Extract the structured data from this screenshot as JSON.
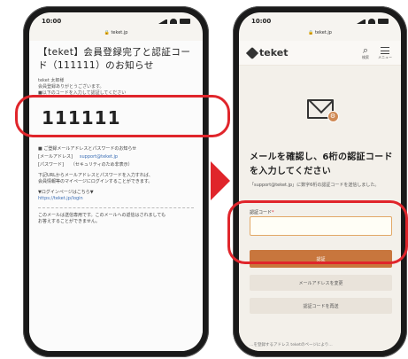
{
  "left_phone": {
    "status_time": "10:00",
    "url": "teket.jp",
    "mail": {
      "subject": "【teket】会員登録完了と認証コード（111111）のお知らせ",
      "greeting": "teket 太郎様",
      "meta_1": "会員登録ありがとうございます。",
      "meta_2": "■以下のコードを入力して認証してください",
      "code": "111111",
      "section_title": "■ ご登録メールアドレスとパスワードのお知らせ",
      "email_label": "[メールアドレス]",
      "email_value": "support@teket.jp",
      "password_label": "[パスワード]",
      "password_value": "（セキュリティのため非表示）",
      "para_1": "下記URLからメールアドレスとパスワードを入力すれば、",
      "para_2": "会員情報等のマイページにログインすることができます。",
      "login_heading": "▼ログインページはこちら▼",
      "login_link": "https://teket.jp/login",
      "footer_1": "このメールは送信専用です。このメールへの返信はされましても",
      "footer_2": "お答えすることができません。"
    }
  },
  "right_phone": {
    "status_time": "10:00",
    "url": "teket.jp",
    "brand": "teket",
    "search_label": "検索",
    "menu_label": "メニュー",
    "badge_icon": "gear-icon",
    "verify_title": "メールを確認し、6桁の認証コードを入力してください",
    "verify_desc": "「support@teket.jp」に数字6桁の認証コードを送信しました。",
    "field_label": "認証コード",
    "required_mark": "*",
    "input_value": "",
    "submit_label": "認証",
    "change_email_label": "メールアドレスを変更",
    "resend_label": "認証コードを再送",
    "footer_note": "…を登録するアドレス teketのページにより…"
  },
  "colors": {
    "highlight": "#e0252b",
    "accent": "#c8763d",
    "input_border": "#e2a867"
  }
}
